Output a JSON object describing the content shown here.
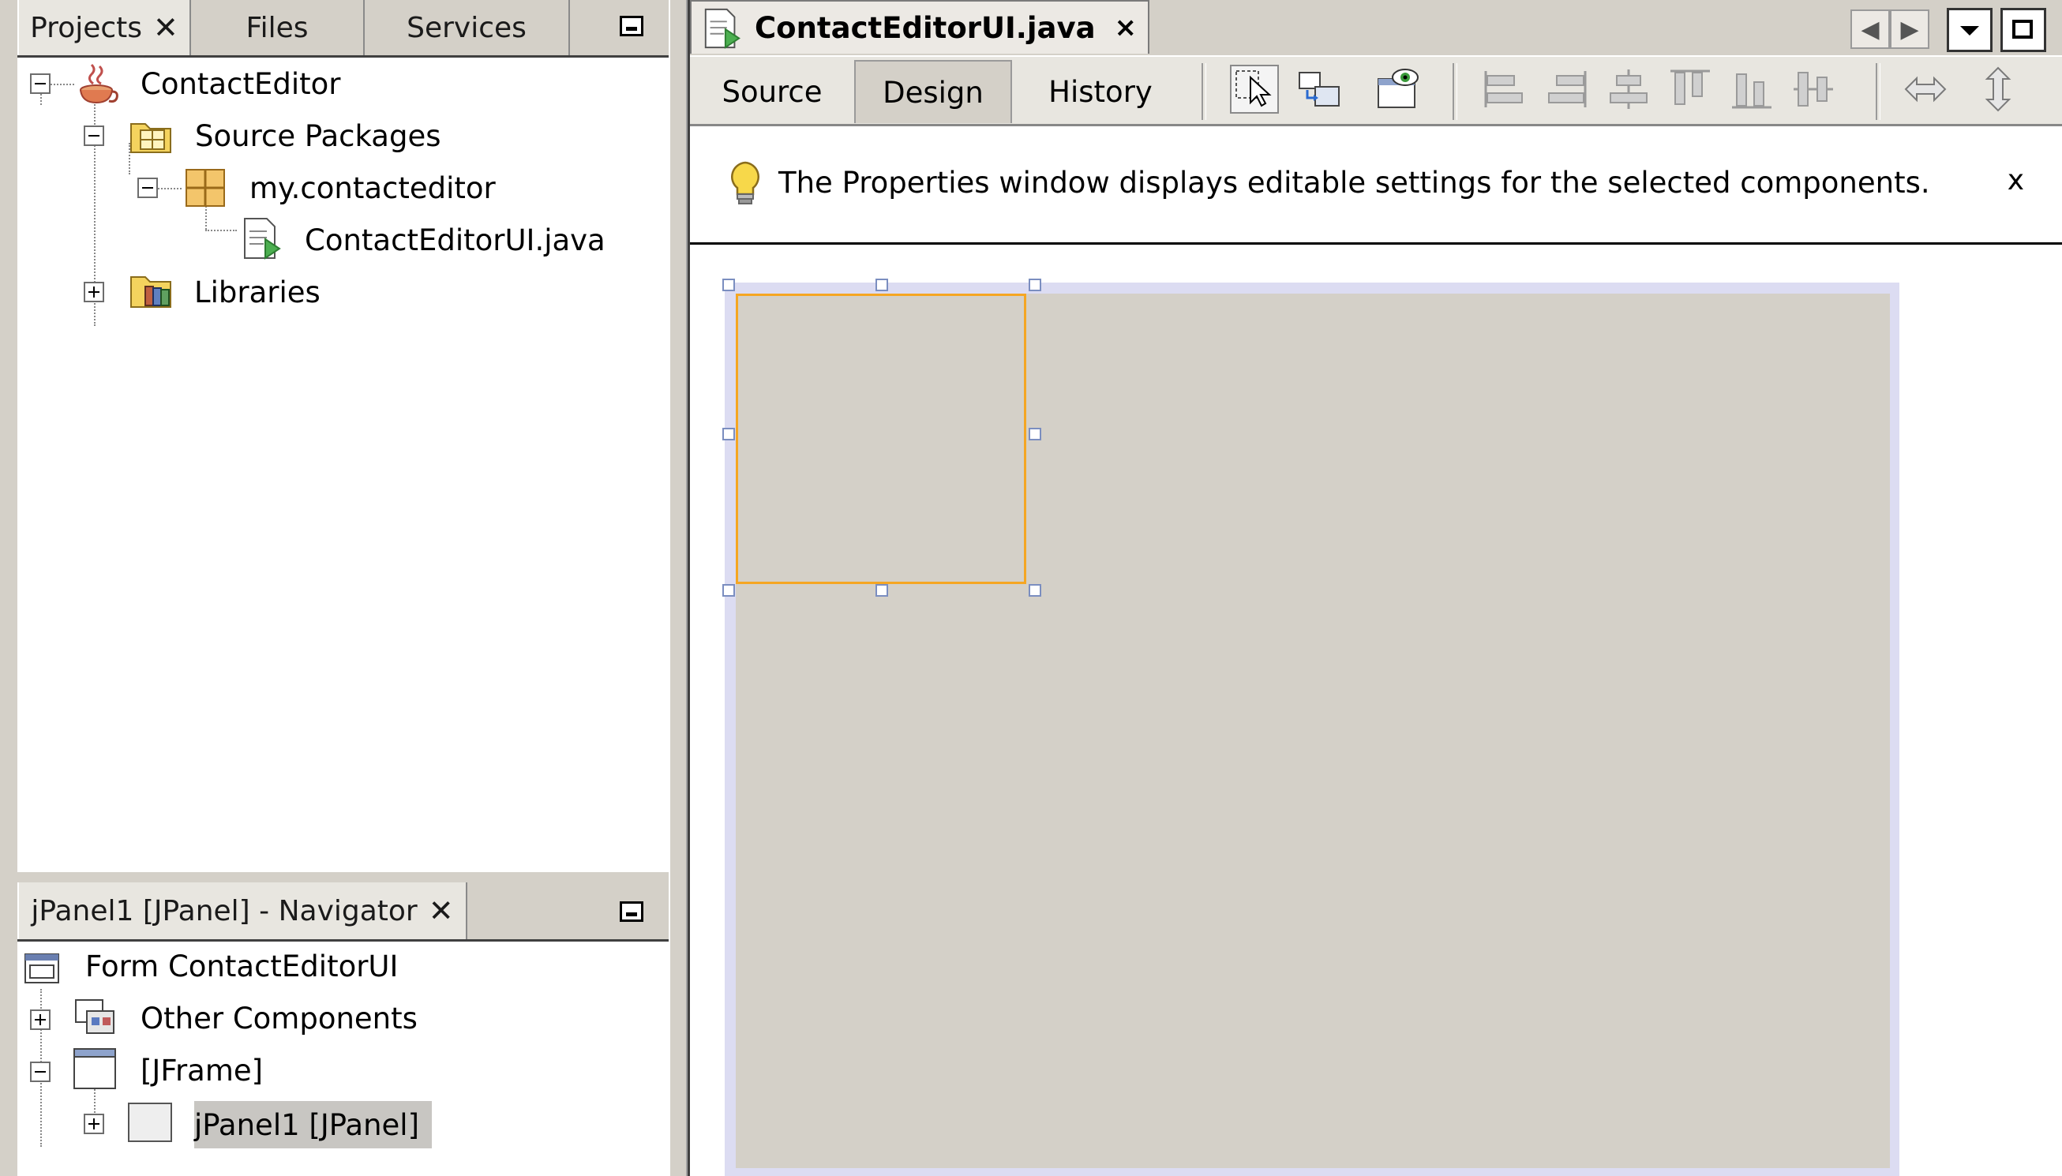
{
  "projects_panel": {
    "tabs": [
      {
        "label": "Projects",
        "active": true,
        "close": "✕"
      },
      {
        "label": "Files",
        "active": false
      },
      {
        "label": "Services",
        "active": false
      }
    ],
    "tree": {
      "project": "ContactEditor",
      "source_packages": "Source Packages",
      "package": "my.contacteditor",
      "file": "ContactEditorUI.java",
      "libraries": "Libraries"
    }
  },
  "navigator_panel": {
    "tab_label": "jPanel1 [JPanel] - Navigator",
    "close": "✕",
    "tree": {
      "form": "Form ContactEditorUI",
      "other_components": "Other Components",
      "jframe": "[JFrame]",
      "jpanel": "jPanel1 [JPanel]"
    }
  },
  "editor": {
    "file_tab": {
      "title": "ContactEditorUI.java",
      "close": "×"
    },
    "view_tabs": [
      {
        "label": "Source",
        "active": false
      },
      {
        "label": "Design",
        "active": true
      },
      {
        "label": "History",
        "active": false
      }
    ],
    "toolbar_icons": [
      "selection-mode-icon",
      "connection-mode-icon",
      "preview-design-icon",
      "align-left-icon",
      "align-right-icon",
      "center-horizontally-icon",
      "align-top-icon",
      "align-bottom-icon",
      "center-vertically-icon",
      "resize-horizontal-icon",
      "resize-vertical-icon"
    ],
    "hint": {
      "text": "The Properties window displays editable settings for the selected components.",
      "close": "x"
    }
  },
  "colors": {
    "chrome": "#d4d0c8",
    "selection_border": "#f5a623",
    "frame_outline": "#dcdcf2",
    "handle_border": "#7b8ec0"
  }
}
